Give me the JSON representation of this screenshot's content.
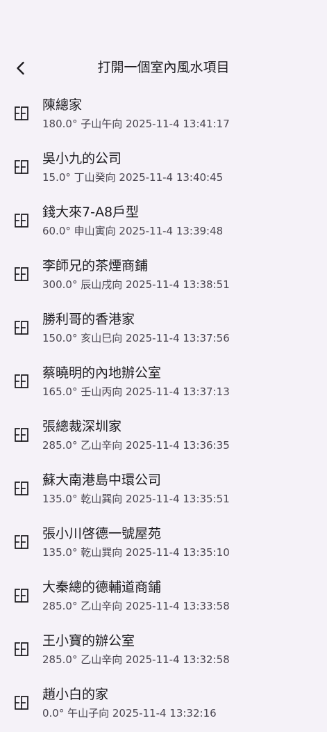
{
  "header": {
    "title": "打開一個室內風水項目",
    "back_icon": "chevron-left-icon"
  },
  "colors": {
    "background": "#f5f2f8",
    "text_primary": "#1c1b1f",
    "text_secondary": "#49454f"
  },
  "items": [
    {
      "name": "陳總家",
      "detail": "180.0° 子山午向 2025-11-4 13:41:17",
      "icon": "floorplan-icon"
    },
    {
      "name": "吳小九的公司",
      "detail": "15.0° 丁山癸向 2025-11-4 13:40:45",
      "icon": "floorplan-icon"
    },
    {
      "name": "錢大來7-A8戶型",
      "detail": "60.0° 申山寅向 2025-11-4 13:39:48",
      "icon": "floorplan-icon"
    },
    {
      "name": "李師兄的茶煙商鋪",
      "detail": "300.0° 辰山戌向 2025-11-4 13:38:51",
      "icon": "floorplan-icon"
    },
    {
      "name": "勝利哥的香港家",
      "detail": "150.0° 亥山巳向 2025-11-4 13:37:56",
      "icon": "floorplan-icon"
    },
    {
      "name": "蔡曉明的內地辦公室",
      "detail": "165.0° 壬山丙向 2025-11-4 13:37:13",
      "icon": "floorplan-icon"
    },
    {
      "name": "張總裁深圳家",
      "detail": "285.0° 乙山辛向 2025-11-4 13:36:35",
      "icon": "floorplan-icon"
    },
    {
      "name": "蘇大南港島中環公司",
      "detail": "135.0° 乾山巽向 2025-11-4 13:35:51",
      "icon": "floorplan-icon"
    },
    {
      "name": "張小川啓德一號屋苑",
      "detail": "135.0° 乾山巽向 2025-11-4 13:35:10",
      "icon": "floorplan-icon"
    },
    {
      "name": "大秦總的德輔道商鋪",
      "detail": "285.0° 乙山辛向 2025-11-4 13:33:58",
      "icon": "floorplan-icon"
    },
    {
      "name": "王小寶的辦公室",
      "detail": "285.0° 乙山辛向 2025-11-4 13:32:58",
      "icon": "floorplan-icon"
    },
    {
      "name": "趙小白的家",
      "detail": "0.0° 午山子向 2025-11-4 13:32:16",
      "icon": "floorplan-icon"
    }
  ]
}
